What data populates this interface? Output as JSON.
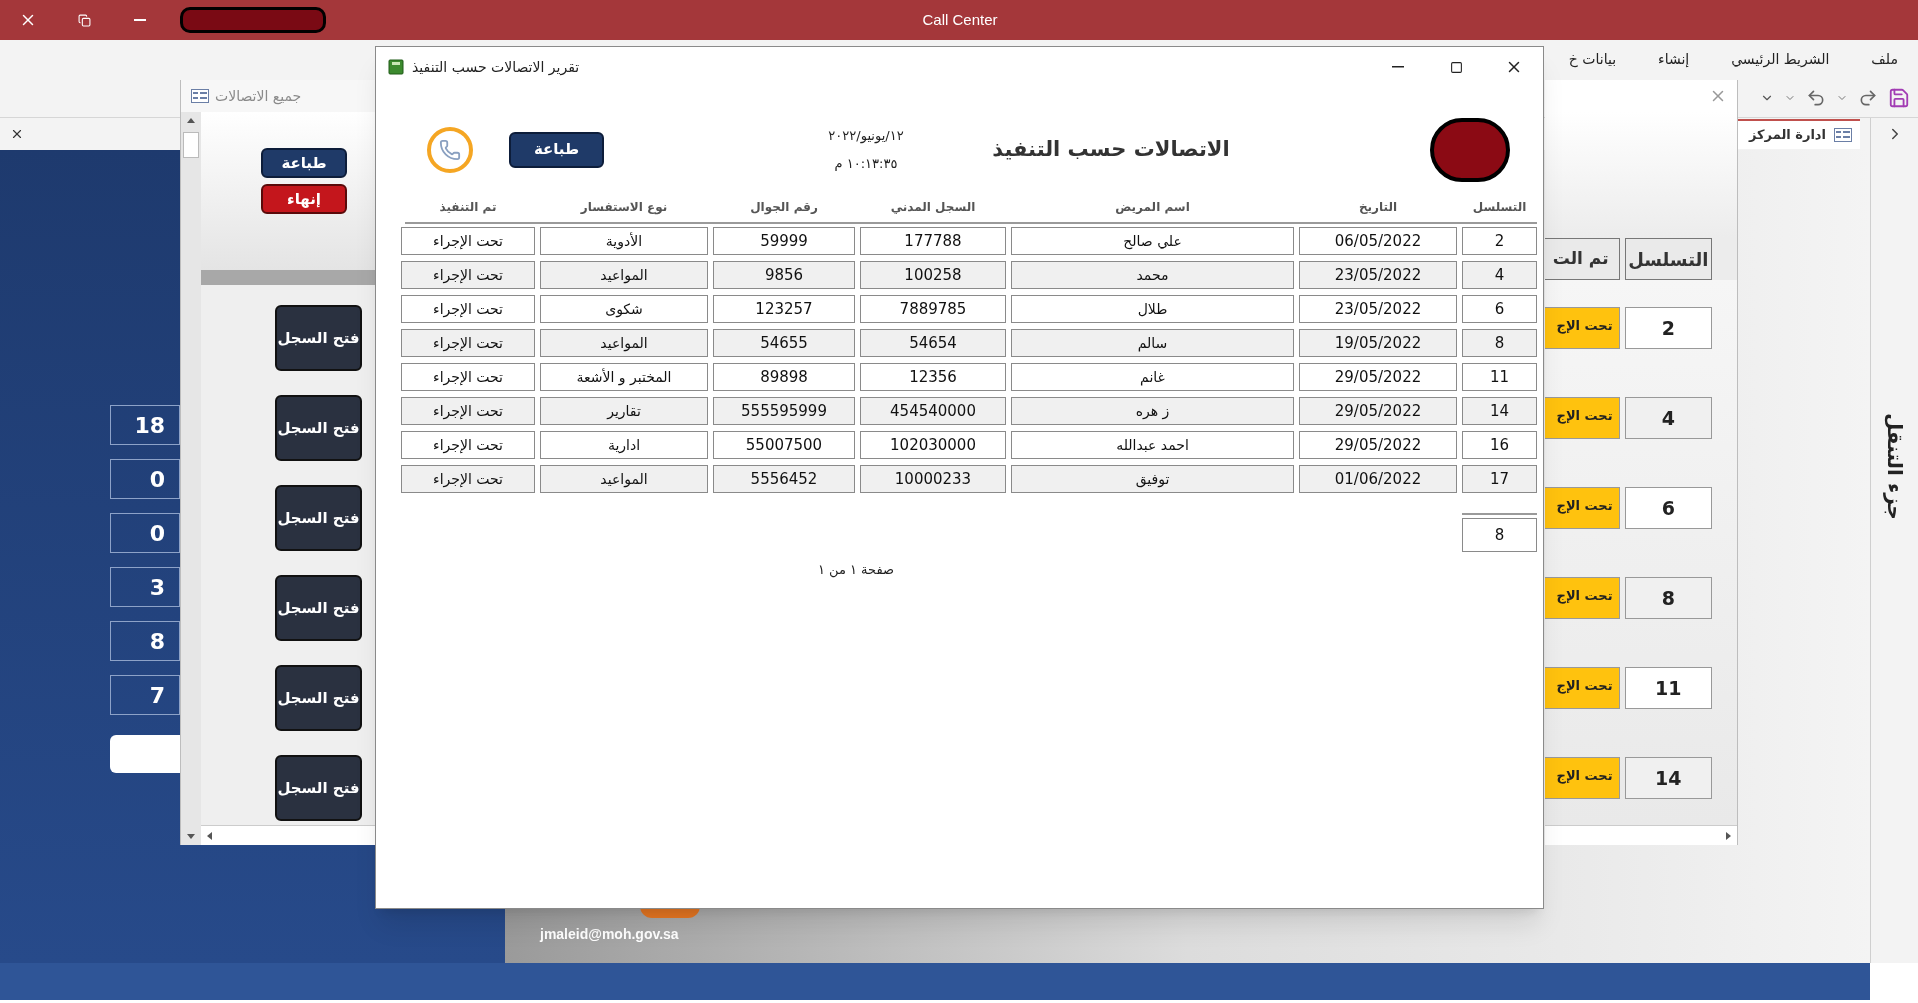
{
  "app": {
    "title": "Call Center"
  },
  "ribbon_tabs": [
    {
      "label": "ملف",
      "selected": false
    },
    {
      "label": "الشريط الرئيسي",
      "selected": false
    },
    {
      "label": "إنشاء",
      "selected": false
    },
    {
      "label": "بيانات خ",
      "selected": false
    }
  ],
  "document_tab": {
    "label": "ادارة المركز"
  },
  "navigation_pane": {
    "label": "جزء التنقل"
  },
  "dashboard": {
    "counts": [
      "18",
      "0",
      "0",
      "3",
      "8",
      "7"
    ],
    "email": "jmaleid@moh.gov.sa"
  },
  "calls_form": {
    "title": "جميع الاتصالات",
    "buttons": [
      {
        "label": "طباعة",
        "kind": "print"
      },
      {
        "label": "إنهاء",
        "kind": "exit"
      }
    ],
    "rows": [
      {
        "open_button": "فتح السجل"
      },
      {
        "open_button": "فتح السجل"
      },
      {
        "open_button": "فتح السجل"
      },
      {
        "open_button": "فتح السجل"
      },
      {
        "open_button": "فتح السجل"
      },
      {
        "open_button": "فتح السجل"
      }
    ]
  },
  "progress_form": {
    "columns": [
      "التسلسل",
      "تم الت"
    ],
    "rows": [
      {
        "serial": "2",
        "status": "تحت الإج"
      },
      {
        "serial": "4",
        "status": "تحت الإج"
      },
      {
        "serial": "6",
        "status": "تحت الإج"
      },
      {
        "serial": "8",
        "status": "تحت الإج"
      },
      {
        "serial": "11",
        "status": "تحت الإج"
      },
      {
        "serial": "14",
        "status": "تحت الإج"
      }
    ]
  },
  "report": {
    "title": "تقرير الاتصالات حسب التنفيذ",
    "heading": "الاتصالات حسب التنفيذ",
    "date": "١٢/يونيو/٢٠٢٢",
    "time": "١٠:١٣:٣٥ م",
    "print_button": "طباعة",
    "columns": [
      "التسلسل",
      "التاريخ",
      "اسم المريض",
      "السجل المدني",
      "رقم الجوال",
      "نوع الاستفسار",
      "تم التنفيذ"
    ],
    "rows": [
      {
        "serial": "2",
        "date": "06/05/2022",
        "patient": "علي صالح",
        "civil_record": "177788",
        "mobile": "59999",
        "inquiry_type": "الأدوية",
        "done": "تحت الإجراء"
      },
      {
        "serial": "4",
        "date": "23/05/2022",
        "patient": "محمد",
        "civil_record": "100258",
        "mobile": "9856",
        "inquiry_type": "المواعيد",
        "done": "تحت الإجراء"
      },
      {
        "serial": "6",
        "date": "23/05/2022",
        "patient": "طلال",
        "civil_record": "7889785",
        "mobile": "123257",
        "inquiry_type": "شكوى",
        "done": "تحت الإجراء"
      },
      {
        "serial": "8",
        "date": "19/05/2022",
        "patient": "سالم",
        "civil_record": "54654",
        "mobile": "54655",
        "inquiry_type": "المواعيد",
        "done": "تحت الإجراء"
      },
      {
        "serial": "11",
        "date": "29/05/2022",
        "patient": "غانم",
        "civil_record": "12356",
        "mobile": "89898",
        "inquiry_type": "المختبر و الأشعة",
        "done": "تحت الإجراء"
      },
      {
        "serial": "14",
        "date": "29/05/2022",
        "patient": "ز هره",
        "civil_record": "454540000",
        "mobile": "555595999",
        "inquiry_type": "تقارير",
        "done": "تحت الإجراء"
      },
      {
        "serial": "16",
        "date": "29/05/2022",
        "patient": "احمد عبدالله",
        "civil_record": "102030000",
        "mobile": "55007500",
        "inquiry_type": "ادارية",
        "done": "تحت الإجراء"
      },
      {
        "serial": "17",
        "date": "01/06/2022",
        "patient": "توفيق",
        "civil_record": "10000233",
        "mobile": "5556452",
        "inquiry_type": "المواعيد",
        "done": "تحت الإجراء"
      }
    ],
    "count": "8",
    "page_label": "صفحة ١ من ١"
  }
}
